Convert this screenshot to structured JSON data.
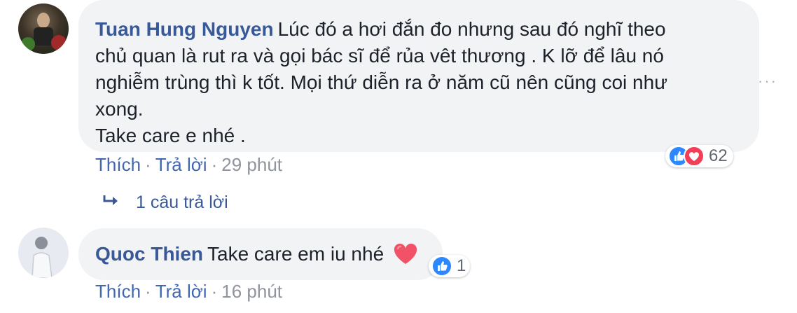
{
  "comments": [
    {
      "author": "Tuan Hung Nguyen",
      "text": "Lúc đó a hơi đắn đo nhưng sau đó nghĩ theo\nchủ quan là rut ra và gọi bác sĩ để rủa vêt thương . K lỡ để lâu nó\nnghiễm trùng thì k tốt. Mọi thứ diễn ra ở năm cũ nên cũng coi như\nxong.\nTake care e nhé .",
      "like_label": "Thích",
      "reply_label": "Trả lời",
      "time": "29 phút",
      "reaction_count": "62",
      "reaction_icons": [
        "like-icon",
        "love-icon"
      ]
    },
    {
      "author": "Quoc Thien",
      "text": "Take care em iu nhé",
      "like_label": "Thích",
      "reply_label": "Trả lời",
      "time": "16 phút",
      "reaction_count": "1",
      "reaction_icons": [
        "like-icon"
      ]
    }
  ],
  "replies_link": "1 câu trả lời",
  "separator": "·",
  "more_options": "···",
  "colors": {
    "link": "#385898",
    "bubble": "#f2f3f5",
    "meta": "#90949c",
    "like": "#2d88ff",
    "love": "#f33e58"
  }
}
